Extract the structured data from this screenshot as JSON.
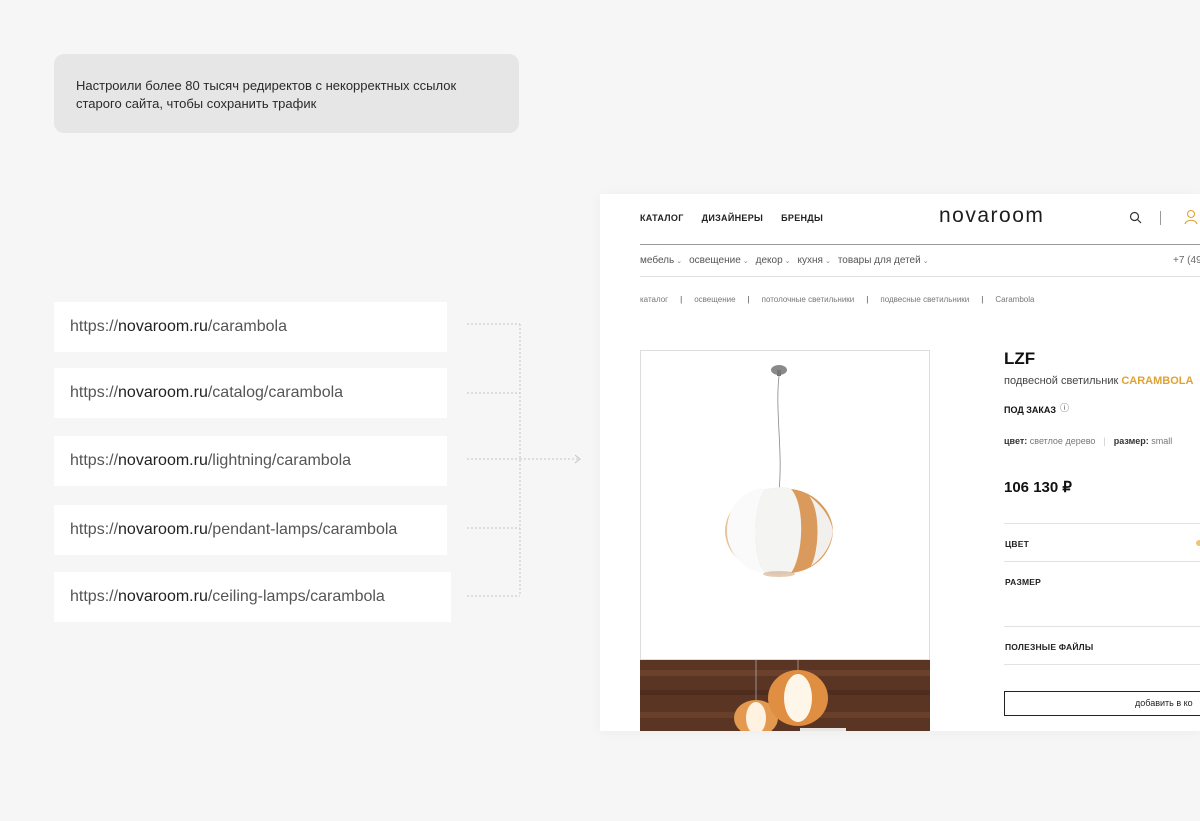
{
  "note": {
    "line1": "Настроили более 80 тысяч редиректов с некорректных ссылок",
    "line2": "старого сайта, чтобы сохранить трафик"
  },
  "urls": [
    {
      "prefix": "https://",
      "domain": "novaroom.ru",
      "path": "/carambola"
    },
    {
      "prefix": "https://",
      "domain": "novaroom.ru",
      "path": "/catalog/carambola"
    },
    {
      "prefix": "https://",
      "domain": "novaroom.ru",
      "path": "/lightning/carambola"
    },
    {
      "prefix": "https://",
      "domain": "novaroom.ru",
      "path": "/pendant-lamps/carambola"
    },
    {
      "prefix": "https://",
      "domain": "novaroom.ru",
      "path": "/ceiling-lamps/carambola"
    }
  ],
  "site": {
    "nav": [
      "КАТАЛОГ",
      "ДИЗАЙНЕРЫ",
      "БРЕНДЫ"
    ],
    "logo": "novaroom",
    "icons": {
      "search": "search-icon",
      "account": "user-icon"
    },
    "categories": [
      "мебель",
      "освещение",
      "декор",
      "кухня",
      "товары для детей"
    ],
    "phone": "+7 (49",
    "breadcrumbs": [
      "каталог",
      "освещение",
      "потолочные светильники",
      "подвесные светильники",
      "Carambola"
    ],
    "product": {
      "brand": "LZF",
      "type": "подвесной светильник",
      "name": "CARAMBOLA",
      "availability": "ПОД ЗАКАЗ",
      "info_icon": "ⓘ",
      "color_label": "цвет:",
      "color_value": "светлое дерево",
      "size_label": "размер:",
      "size_value": "small",
      "price": "106 130 ₽"
    },
    "options": {
      "color": "ЦВЕТ",
      "size": "РАЗМЕР",
      "files": "ПОЛЕЗНЫЕ ФАЙЛЫ"
    },
    "add_button": "добавить в ко",
    "accent": "#e0a230"
  }
}
